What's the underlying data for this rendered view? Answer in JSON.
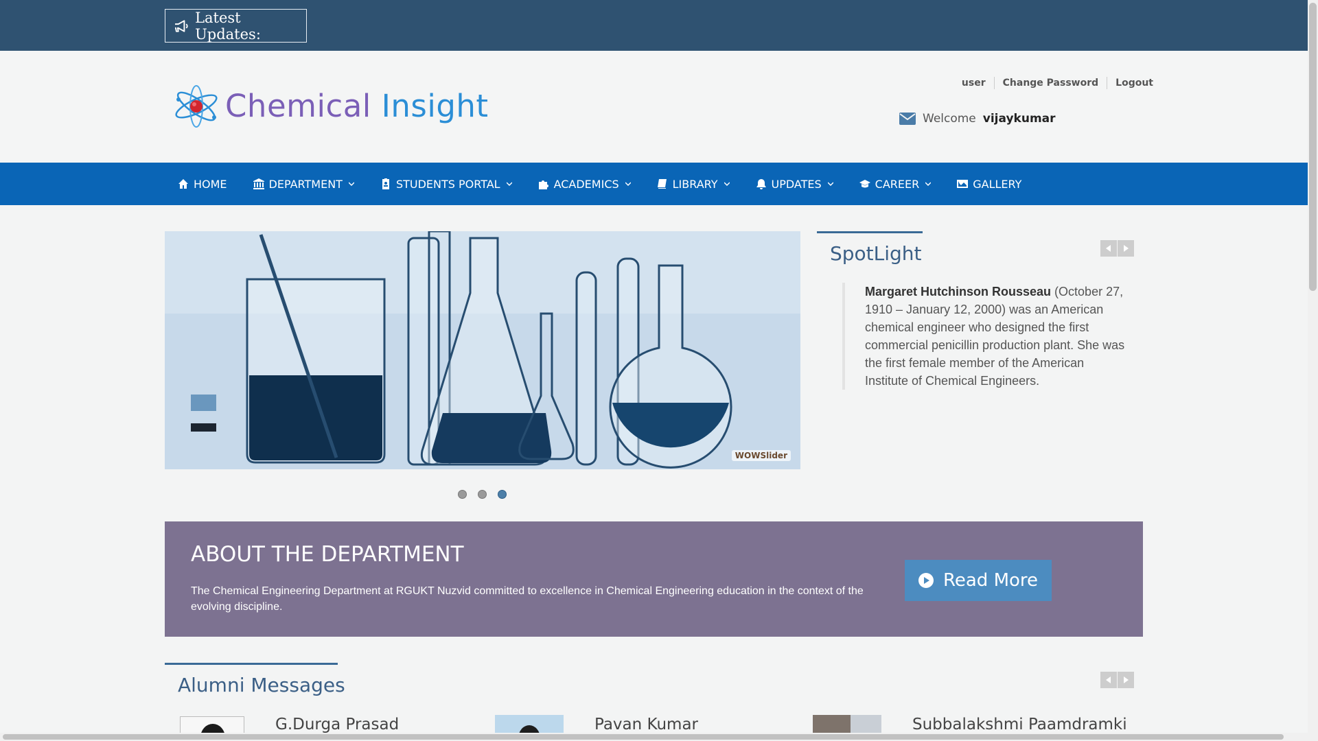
{
  "topbar": {
    "updates_label": "Latest Updates:"
  },
  "header": {
    "logo": {
      "word1": "Chemical",
      "word2": "Insight"
    },
    "user_links": [
      "user",
      "Change Password",
      "Logout"
    ],
    "welcome_text": "Welcome",
    "username": "vijaykumar"
  },
  "nav": {
    "items": [
      {
        "label": "HOME",
        "icon": "home-icon",
        "dropdown": false
      },
      {
        "label": "DEPARTMENT",
        "icon": "bank-icon",
        "dropdown": true
      },
      {
        "label": "STUDENTS PORTAL",
        "icon": "id-card-icon",
        "dropdown": true
      },
      {
        "label": "ACADEMICS",
        "icon": "puzzle-icon",
        "dropdown": true
      },
      {
        "label": "LIBRARY",
        "icon": "book-icon",
        "dropdown": true
      },
      {
        "label": "UPDATES",
        "icon": "bell-icon",
        "dropdown": true
      },
      {
        "label": "CAREER",
        "icon": "graduation-cap-icon",
        "dropdown": true
      },
      {
        "label": "GALLERY",
        "icon": "image-icon",
        "dropdown": false
      }
    ]
  },
  "slider": {
    "watermark": "WOWSlider",
    "slide_count": 3,
    "active_slide": 3
  },
  "spotlight": {
    "title": "SpotLight",
    "name": "Margaret Hutchinson Rousseau",
    "text": " (October 27, 1910 – January 12, 2000) was an American chemical engineer who designed the first commercial penicillin production plant. She was the first female member of the American Institute of Chemical Engineers."
  },
  "about": {
    "title": "ABOUT THE DEPARTMENT",
    "text": "The Chemical Engineering Department at RGUKT Nuzvid committed to excellence in Chemical Engineering education in the context of the evolving discipline.",
    "button_label": "Read More"
  },
  "alumni": {
    "title": "Alumni Messages",
    "people": [
      {
        "name": "G.Durga Prasad"
      },
      {
        "name": "Pavan Kumar"
      },
      {
        "name": "Subbalakshmi Paamdramki"
      }
    ]
  },
  "colors": {
    "topbar": "#2f5271",
    "nav": "#0a65b6",
    "about_bg": "#7d7291",
    "accent": "#3b5f86",
    "button": "#4c8cc0"
  }
}
